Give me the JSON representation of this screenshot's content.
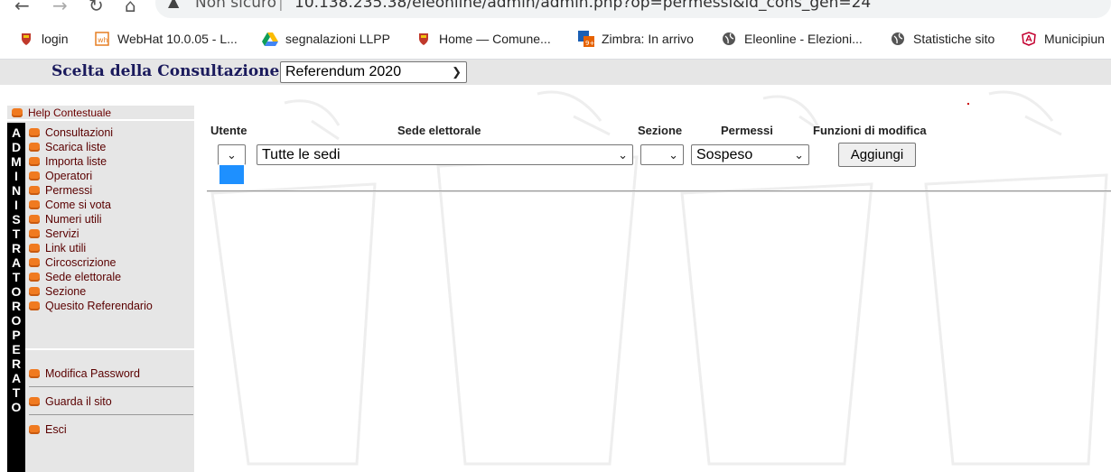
{
  "browser": {
    "not_secure": "Non sicuro",
    "url": "10.138.235.38/eleonline/admin/admin.php?op=permessi&id_cons_gen=24",
    "bookmarks": [
      {
        "label": "login",
        "icon": "crest-icon"
      },
      {
        "label": "WebHat 10.0.05 - L...",
        "icon": "webhat-icon"
      },
      {
        "label": "segnalazioni LLPP",
        "icon": "drive-icon"
      },
      {
        "label": "Home — Comune...",
        "icon": "crest-icon"
      },
      {
        "label": "Zimbra: In arrivo",
        "icon": "zimbra-icon"
      },
      {
        "label": "Eleonline - Elezioni...",
        "icon": "globe-icon"
      },
      {
        "label": "Statistiche sito",
        "icon": "globe-icon"
      },
      {
        "label": "Municipiun",
        "icon": "angular-icon"
      }
    ]
  },
  "topbar": {
    "label": "Scelta della Consultazione:",
    "selected": "Referendum 2020"
  },
  "sidebar": {
    "help": "Help Contestuale",
    "vertical_text": [
      "A",
      "D",
      "M",
      "I",
      "N",
      "I",
      "S",
      "T",
      "R",
      "A",
      "T",
      "O",
      "R",
      "O",
      "P",
      "E",
      "R",
      "A",
      "T",
      "O"
    ],
    "menu": [
      "Consultazioni",
      "Scarica liste",
      "Importa liste",
      "Operatori",
      "Permessi",
      "Come si vota",
      "Numeri utili",
      "Servizi",
      "Link utili",
      "Circoscrizione",
      "Sede elettorale",
      "Sezione",
      "Quesito Referendario"
    ],
    "bottom": [
      "Modifica Password",
      "Guarda il sito",
      "Esci"
    ]
  },
  "form": {
    "headers": {
      "utente": "Utente",
      "sede": "Sede elettorale",
      "sezione": "Sezione",
      "permessi": "Permessi",
      "funzioni": "Funzioni di modifica"
    },
    "utente_value": "",
    "sede_value": "Tutte le sedi",
    "sezione_value": "",
    "permessi_value": "Sospeso",
    "add_label": "Aggiungi"
  },
  "colors": {
    "accent_orange": "#f07a20",
    "menu_text": "#5a0000",
    "topbar_text": "#1a1a5c",
    "dropdown_highlight": "#1e90ff"
  }
}
